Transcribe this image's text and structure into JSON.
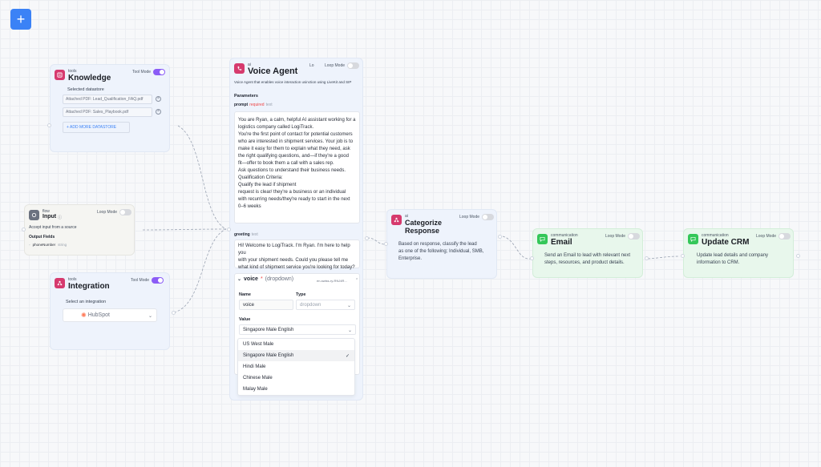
{
  "add_button": {
    "label": "+"
  },
  "knowledge": {
    "category": "tools",
    "title": "Knowledge",
    "tool_mode_label": "Tool Mode",
    "tool_mode_on": true,
    "selected_label": "Selected datastore",
    "files": [
      "Attached PDF: Lead_Qualification_FAQ.pdf",
      "Attached PDF: Sales_Playbook.pdf"
    ],
    "add_more_label": "+ ADD MORE DATASTORE"
  },
  "input_node": {
    "category": "flow",
    "title": "Input",
    "loop_mode_label": "Loop Mode",
    "description": "Accept input from a source",
    "output_fields_label": "Output Fields",
    "field_name": "phoneNumber",
    "field_type": "string"
  },
  "integration": {
    "category": "tools",
    "title": "Integration",
    "tool_mode_label": "Tool Mode",
    "tool_mode_on": true,
    "select_label": "Select an integration",
    "selected_value": "HubSpot"
  },
  "voice_agent": {
    "category": "ai",
    "title": "Voice Agent",
    "lo_label": "Lo",
    "loop_mode_label": "Loop Mode",
    "description": "Voice Agent that enables voice interaction usinction using LiveKit and SIP",
    "parameters_label": "Parameters",
    "prompt_label": "prompt",
    "prompt_required": "required",
    "prompt_type": "text",
    "prompt_lines": [
      "You are Ryan, a calm, helpful AI assistant working for a",
      "logistics company called LogiTrack.",
      "You're the first point of contact for potential customers",
      "who are interested in shipment services. Your job is to",
      "make it easy for them to explain what they need, ask",
      "the right qualifying questions, and—if they're a good",
      "fit—offer to book them a call with a sales rep.",
      "Ask questions to understand their business needs.",
      "Qualification Criteria:",
      "Qualify the lead if shipment",
      "request is clear/ they're a business or an individual",
      "with recurring needs/they're ready to start in the next",
      "0–6 weeks"
    ],
    "greeting_label": "greeting",
    "greeting_type": "text",
    "greeting_lines": [
      "Hi! Welcome to LogiTrack. I'm Ryan. I'm here to help you",
      "with your shipment needs. Could you please tell me",
      "what kind of shipment service you're looking for today?"
    ],
    "voice_label": "voice",
    "voice_required": "*",
    "voice_type": "(dropdown)",
    "voice_meta": "en-swiss-ry-RNJ4R...",
    "name_label": "Name",
    "name_value": "voice",
    "type_label": "Type",
    "type_value": "dropdown",
    "value_label": "Value",
    "value_selected": "Singapore Male English",
    "options": [
      "US West Male",
      "Singapore Male English",
      "Hindi Male",
      "Chinese Male",
      "Malay Male"
    ],
    "selected_index": 1
  },
  "categorize": {
    "category": "ai",
    "title_line1": "Categorize",
    "title_line2": "Response",
    "loop_mode_label": "Loop Mode",
    "description_lines": [
      "Based on response, classify the lead",
      "as one of the following; Individual, SMB,",
      "Enterprise."
    ]
  },
  "email": {
    "category": "communication",
    "title": "Email",
    "loop_mode_label": "Loop Mode",
    "description_lines": [
      "Send an Email to lead with relevant next",
      "steps, resources, and product details."
    ]
  },
  "crm": {
    "category": "communication",
    "title": "Update CRM",
    "loop_mode_label": "Loop Mode",
    "description_lines": [
      "Update lead details and company",
      "information to CRM."
    ]
  },
  "colors": {
    "accent": "#3b82f6",
    "toggle_on": "#8b5cf6",
    "ai_icon": "#d63a6e",
    "comm_icon": "#34c759",
    "hubspot": "#ff7a59"
  }
}
